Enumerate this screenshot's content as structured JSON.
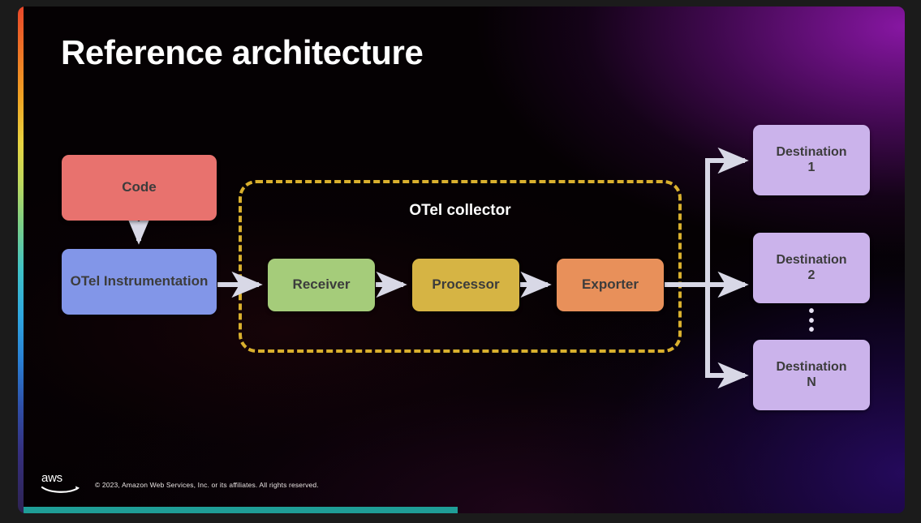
{
  "slide": {
    "title": "Reference architecture",
    "accent_bar": {
      "name": "rainbow-gradient-bar",
      "colors": [
        "#e8472a",
        "#f0a323",
        "#e8d441",
        "#7bcf87",
        "#3fc2c7",
        "#2a7fd4",
        "#2e2352"
      ]
    },
    "progress_bar": {
      "color": "#1f9e97"
    },
    "background_colors": {
      "base": "#050103",
      "glow_top_right": "#9218b0",
      "glow_bottom_right": "#260a60",
      "page": "#1b1b1b"
    }
  },
  "diagram": {
    "type": "flow",
    "source_nodes": [
      {
        "id": "code",
        "label": "Code",
        "color": "#e8726e",
        "text_color": "#3c3c3c"
      },
      {
        "id": "otel-instrumentation",
        "label": "OTel Instrumentation",
        "color": "#8296e8",
        "text_color": "#3c3c3c"
      }
    ],
    "collector": {
      "label": "OTel collector",
      "label_color": "#ffffff",
      "border_color": "#d9b02e",
      "border_style": "dashed",
      "stages": [
        {
          "id": "receiver",
          "label": "Receiver",
          "color": "#a5cc7a",
          "text_color": "#3c3c3c"
        },
        {
          "id": "processor",
          "label": "Processor",
          "color": "#d6b444",
          "text_color": "#3c3c3c"
        },
        {
          "id": "exporter",
          "label": "Exporter",
          "color": "#e8905a",
          "text_color": "#3c3c3c"
        }
      ]
    },
    "destinations": [
      {
        "id": "destination-1",
        "line1": "Destination",
        "line2": "1",
        "color": "#cbb3eb",
        "text_color": "#3c3c3c"
      },
      {
        "id": "destination-2",
        "line1": "Destination",
        "line2": "2",
        "color": "#cbb3eb",
        "text_color": "#3c3c3c"
      },
      {
        "id": "destination-n",
        "line1": "Destination",
        "line2": "N",
        "color": "#cbb3eb",
        "text_color": "#3c3c3c"
      }
    ],
    "ellipsis": "•",
    "arrow_color": "#d8d8e6"
  },
  "footer": {
    "logo_text": "aws",
    "copyright": "© 2023, Amazon Web Services, Inc. or its affiliates. All rights reserved."
  }
}
